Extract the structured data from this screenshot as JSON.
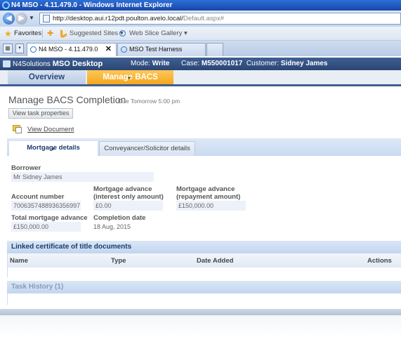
{
  "browser": {
    "window_title": "N4 MSO - 4.11.479.0 - Windows Internet Explorer",
    "url_prefix": "http://desktop.aui.r12pdt.poulton.avelo.local/",
    "url_suffix": "Default.aspx#",
    "favorites_label": "Favorites",
    "suggested_sites": "Suggested Sites ▾",
    "web_slice": "Web Slice Gallery ▾",
    "tabs": [
      {
        "label": "N4 MSO - 4.11.479.0",
        "close": "✕"
      },
      {
        "label": "MSO Test Harness"
      }
    ]
  },
  "app": {
    "brand_prefix": "N4Solutions",
    "brand_name": "MSO Desktop",
    "mode_label": "Mode:",
    "mode_value": "Write",
    "case_label": "Case:",
    "case_value": "M550001017",
    "customer_label": "Customer:",
    "customer_value": "Sidney James",
    "nav_tabs": [
      "Overview",
      "Manage BACS Comp..."
    ]
  },
  "page": {
    "title": "Manage BACS Completion",
    "due": "Due Tomorrow 5:00 pm",
    "view_props_button": "View task properties",
    "view_document": "View Document"
  },
  "detail_tabs": [
    "Mortgage details",
    "Conveyancer/Solicitor details"
  ],
  "form": {
    "borrower_label": "Borrower",
    "borrower_value": "Mr Sidney James",
    "account_label": "Account number",
    "account_value": "7006357488936356997",
    "adv_io_label_1": "Mortgage advance",
    "adv_io_label_2": "(interest only amount)",
    "adv_io_value": "£0.00",
    "adv_rep_label_1": "Mortgage advance",
    "adv_rep_label_2": "(repayment amount)",
    "adv_rep_value": "£150,000.00",
    "total_label": "Total mortgage advance",
    "total_value": "£150,000.00",
    "completion_label": "Completion date",
    "completion_value": "18 Aug, 2015"
  },
  "linked_docs": {
    "title": "Linked certificate of title documents",
    "columns": [
      "Name",
      "Type",
      "Date Added",
      "Actions"
    ]
  },
  "task_history": {
    "title": "Task History (1)"
  },
  "colors": {
    "accent_orange": "#f4a81c",
    "header_navy": "#2b4674",
    "panel_blue": "#c3d6ef"
  }
}
